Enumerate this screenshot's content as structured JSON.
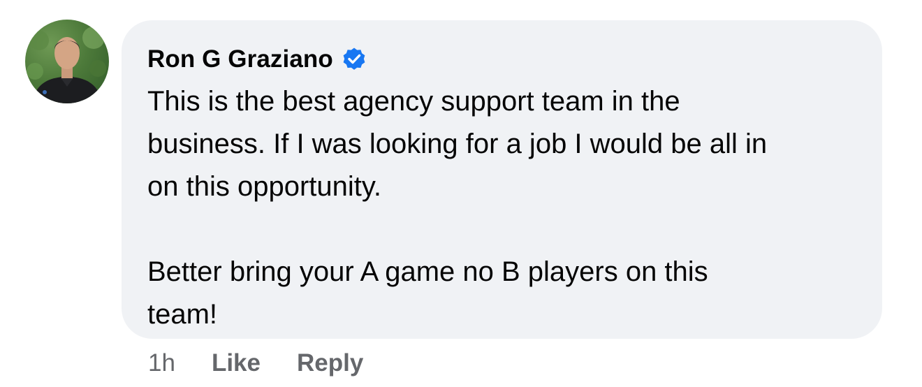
{
  "comment": {
    "author": "Ron G Graziano",
    "verified_icon": "verified-badge-icon",
    "verified_color": "#1877f2",
    "text": "This is the best agency support team in the\nbusiness. If I was looking for a job I would be all in\non this opportunity.\n\nBetter bring your A game no B players on this\nteam!",
    "bubble_color": "#f0f2f5"
  },
  "actions": {
    "timestamp": "1h",
    "like_label": "Like",
    "reply_label": "Reply",
    "color": "#65676b"
  }
}
